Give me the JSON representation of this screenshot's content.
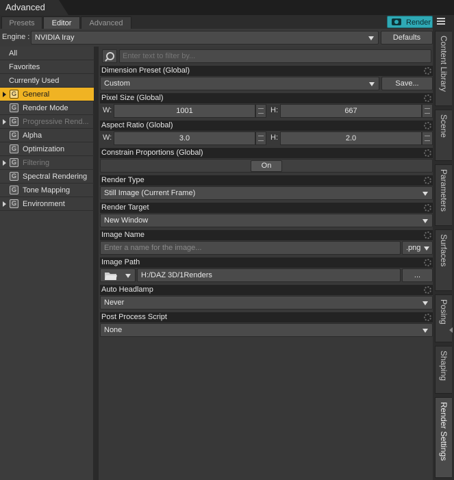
{
  "window": {
    "title": "Advanced"
  },
  "tabs": [
    {
      "label": "Presets",
      "active": false
    },
    {
      "label": "Editor",
      "active": true
    },
    {
      "label": "Advanced",
      "active": false
    }
  ],
  "render_button": {
    "label": "Render",
    "color": "#2fa9b5"
  },
  "engine": {
    "label": "Engine :",
    "value": "NVIDIA Iray",
    "defaults_label": "Defaults"
  },
  "nav": {
    "top_items": [
      {
        "label": "All"
      },
      {
        "label": "Favorites"
      },
      {
        "label": "Currently Used"
      }
    ],
    "groups": [
      {
        "label": "General",
        "expandable": true,
        "selected": true,
        "dim": false,
        "icon": "G"
      },
      {
        "label": "Render Mode",
        "expandable": false,
        "selected": false,
        "dim": false,
        "icon": "G"
      },
      {
        "label": "Progressive Rend...",
        "expandable": true,
        "selected": false,
        "dim": true,
        "icon": "G"
      },
      {
        "label": "Alpha",
        "expandable": false,
        "selected": false,
        "dim": false,
        "icon": "G"
      },
      {
        "label": "Optimization",
        "expandable": false,
        "selected": false,
        "dim": false,
        "icon": "G"
      },
      {
        "label": "Filtering",
        "expandable": true,
        "selected": false,
        "dim": true,
        "icon": "G"
      },
      {
        "label": "Spectral Rendering",
        "expandable": false,
        "selected": false,
        "dim": false,
        "icon": "G"
      },
      {
        "label": "Tone Mapping",
        "expandable": false,
        "selected": false,
        "dim": false,
        "icon": "G"
      },
      {
        "label": "Environment",
        "expandable": true,
        "selected": false,
        "dim": false,
        "icon": "G"
      }
    ],
    "selected_color": "#f0b323"
  },
  "filter": {
    "placeholder": "Enter text to filter by..."
  },
  "settings": {
    "dimension_preset": {
      "title": "Dimension Preset (Global)",
      "value": "Custom",
      "save_label": "Save..."
    },
    "pixel_size": {
      "title": "Pixel Size (Global)",
      "w_label": "W:",
      "w_value": "1001",
      "h_label": "H:",
      "h_value": "667"
    },
    "aspect_ratio": {
      "title": "Aspect Ratio (Global)",
      "w_label": "W:",
      "w_value": "3.0",
      "h_label": "H:",
      "h_value": "2.0"
    },
    "constrain": {
      "title": "Constrain Proportions (Global)",
      "value": "On"
    },
    "render_type": {
      "title": "Render Type",
      "value": "Still Image (Current Frame)"
    },
    "render_target": {
      "title": "Render Target",
      "value": "New Window"
    },
    "image_name": {
      "title": "Image Name",
      "placeholder": "Enter a name for the image...",
      "ext": ".png"
    },
    "image_path": {
      "title": "Image Path",
      "value": "H:/DAZ 3D/1Renders",
      "browse_label": "..."
    },
    "auto_headlamp": {
      "title": "Auto Headlamp",
      "value": "Never"
    },
    "post_process": {
      "title": "Post Process Script",
      "value": "None"
    }
  },
  "right_tabs": [
    {
      "label": "Content Library",
      "active": false
    },
    {
      "label": "Scene",
      "active": false
    },
    {
      "label": "Parameters",
      "active": false
    },
    {
      "label": "Surfaces",
      "active": false
    },
    {
      "label": "Posing",
      "active": false
    },
    {
      "label": "Shaping",
      "active": false
    },
    {
      "label": "Render Settings",
      "active": true
    }
  ]
}
